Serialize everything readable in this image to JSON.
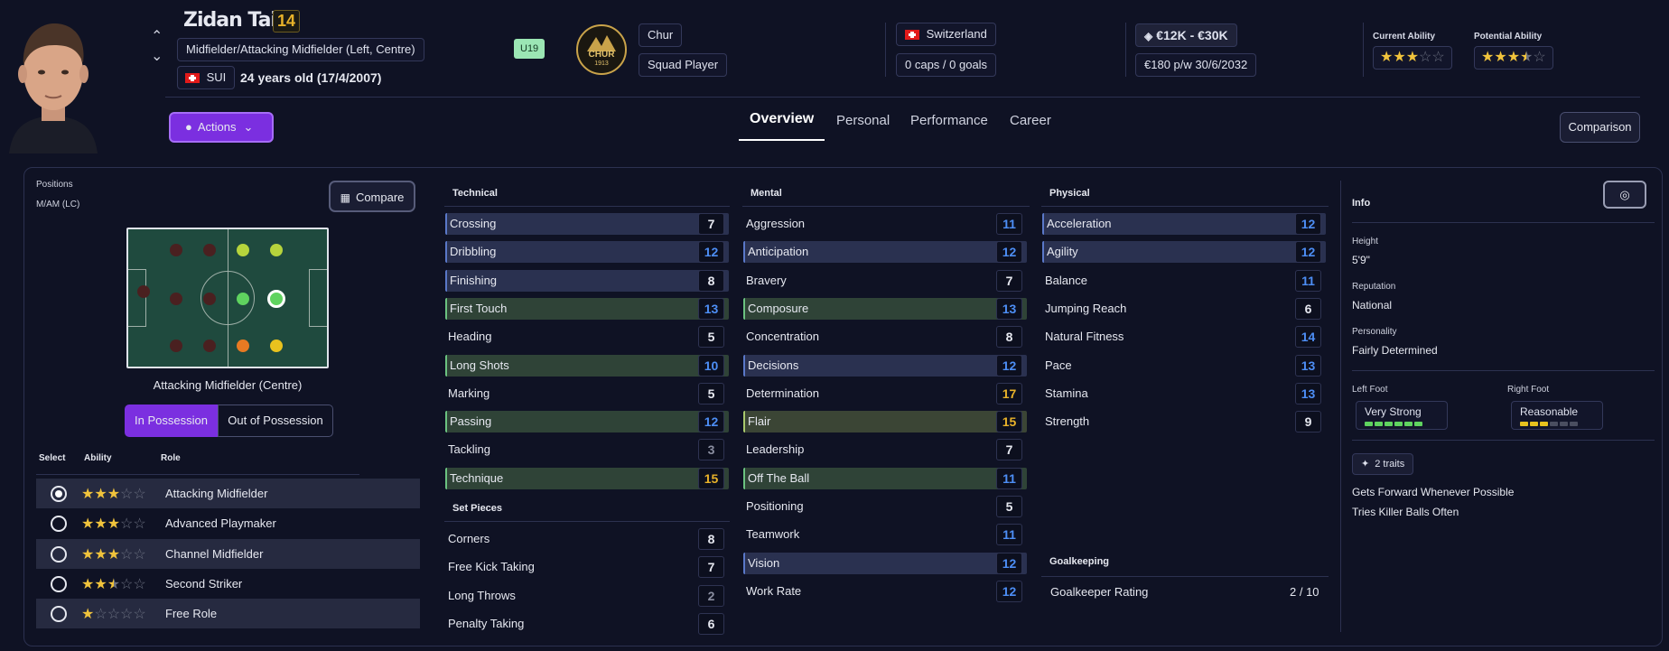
{
  "player": {
    "name": "Zidan Tairi",
    "number": "14",
    "position": "Midfielder/Attacking Midfielder (Left, Centre)",
    "nation_code": "SUI",
    "age": "24 years old (17/4/2007)",
    "age_group": "U19"
  },
  "club": {
    "name": "Chur",
    "role": "Squad Player",
    "badge_text": "CHUR",
    "badge_year": "1913"
  },
  "nation": {
    "name": "Switzerland",
    "caps": "0 caps / 0 goals"
  },
  "value": {
    "range": "€12K - €30K",
    "wage": "€180 p/w 30/6/2032"
  },
  "ability": {
    "current_label": "Current Ability",
    "potential_label": "Potential Ability",
    "current_stars": 3,
    "potential_stars": 3.5
  },
  "nav": {
    "actions": "Actions",
    "tabs": [
      "Overview",
      "Personal",
      "Performance",
      "Career"
    ],
    "active_tab": "Overview",
    "comparison": "Comparison"
  },
  "positions": {
    "label": "Positions",
    "value": "M/AM (LC)",
    "compare": "Compare",
    "pitch_caption": "Attacking Midfielder (Centre)",
    "in_possession": "In Possession",
    "out_possession": "Out of Possession"
  },
  "roles": {
    "headers": {
      "select": "Select",
      "ability": "Ability",
      "role": "Role"
    },
    "items": [
      {
        "name": "Attacking Midfielder",
        "stars": 3,
        "selected": true
      },
      {
        "name": "Advanced Playmaker",
        "stars": 3,
        "selected": false
      },
      {
        "name": "Channel Midfielder",
        "stars": 3,
        "selected": false
      },
      {
        "name": "Second Striker",
        "stars": 2.5,
        "selected": false
      },
      {
        "name": "Free Role",
        "stars": 1,
        "selected": false
      }
    ]
  },
  "attributes": {
    "technical": {
      "title": "Technical",
      "items": [
        {
          "name": "Crossing",
          "value": "7",
          "color": "white",
          "hl": "blue"
        },
        {
          "name": "Dribbling",
          "value": "12",
          "color": "blue",
          "hl": "blue"
        },
        {
          "name": "Finishing",
          "value": "8",
          "color": "white",
          "hl": "blue"
        },
        {
          "name": "First Touch",
          "value": "13",
          "color": "blue",
          "hl": "green"
        },
        {
          "name": "Heading",
          "value": "5",
          "color": "white",
          "hl": ""
        },
        {
          "name": "Long Shots",
          "value": "10",
          "color": "blue",
          "hl": "green"
        },
        {
          "name": "Marking",
          "value": "5",
          "color": "white",
          "hl": ""
        },
        {
          "name": "Passing",
          "value": "12",
          "color": "blue",
          "hl": "green"
        },
        {
          "name": "Tackling",
          "value": "3",
          "color": "grey",
          "hl": ""
        },
        {
          "name": "Technique",
          "value": "15",
          "color": "gold",
          "hl": "green"
        }
      ]
    },
    "set_pieces": {
      "title": "Set Pieces",
      "items": [
        {
          "name": "Corners",
          "value": "8",
          "color": "white",
          "hl": ""
        },
        {
          "name": "Free Kick Taking",
          "value": "7",
          "color": "white",
          "hl": ""
        },
        {
          "name": "Long Throws",
          "value": "2",
          "color": "grey",
          "hl": ""
        },
        {
          "name": "Penalty Taking",
          "value": "6",
          "color": "white",
          "hl": ""
        }
      ]
    },
    "mental": {
      "title": "Mental",
      "items": [
        {
          "name": "Aggression",
          "value": "11",
          "color": "blue",
          "hl": ""
        },
        {
          "name": "Anticipation",
          "value": "12",
          "color": "blue",
          "hl": "blue"
        },
        {
          "name": "Bravery",
          "value": "7",
          "color": "white",
          "hl": ""
        },
        {
          "name": "Composure",
          "value": "13",
          "color": "blue",
          "hl": "green"
        },
        {
          "name": "Concentration",
          "value": "8",
          "color": "white",
          "hl": ""
        },
        {
          "name": "Decisions",
          "value": "12",
          "color": "blue",
          "hl": "blue"
        },
        {
          "name": "Determination",
          "value": "17",
          "color": "gold",
          "hl": ""
        },
        {
          "name": "Flair",
          "value": "15",
          "color": "gold",
          "hl": "gold"
        },
        {
          "name": "Leadership",
          "value": "7",
          "color": "white",
          "hl": ""
        },
        {
          "name": "Off The Ball",
          "value": "11",
          "color": "blue",
          "hl": "green"
        },
        {
          "name": "Positioning",
          "value": "5",
          "color": "white",
          "hl": ""
        },
        {
          "name": "Teamwork",
          "value": "11",
          "color": "blue",
          "hl": ""
        },
        {
          "name": "Vision",
          "value": "12",
          "color": "blue",
          "hl": "blue"
        },
        {
          "name": "Work Rate",
          "value": "12",
          "color": "blue",
          "hl": ""
        }
      ]
    },
    "physical": {
      "title": "Physical",
      "items": [
        {
          "name": "Acceleration",
          "value": "12",
          "color": "blue",
          "hl": "blue"
        },
        {
          "name": "Agility",
          "value": "12",
          "color": "blue",
          "hl": "blue"
        },
        {
          "name": "Balance",
          "value": "11",
          "color": "blue",
          "hl": ""
        },
        {
          "name": "Jumping Reach",
          "value": "6",
          "color": "white",
          "hl": ""
        },
        {
          "name": "Natural Fitness",
          "value": "14",
          "color": "blue",
          "hl": ""
        },
        {
          "name": "Pace",
          "value": "13",
          "color": "blue",
          "hl": ""
        },
        {
          "name": "Stamina",
          "value": "13",
          "color": "blue",
          "hl": ""
        },
        {
          "name": "Strength",
          "value": "9",
          "color": "white",
          "hl": ""
        }
      ]
    },
    "goalkeeping": {
      "title": "Goalkeeping",
      "label": "Goalkeeper Rating",
      "value": "2 / 10"
    }
  },
  "info": {
    "title": "Info",
    "height_label": "Height",
    "height": "5'9\"",
    "reputation_label": "Reputation",
    "reputation": "National",
    "personality_label": "Personality",
    "personality": "Fairly Determined",
    "left_foot_label": "Left Foot",
    "left_foot": "Very Strong",
    "left_foot_level": 6,
    "right_foot_label": "Right Foot",
    "right_foot": "Reasonable",
    "right_foot_level": 3,
    "traits_button": "2 traits",
    "traits": [
      "Gets Forward Whenever Possible",
      "Tries Killer Balls Often"
    ]
  },
  "colors": {
    "accent": "#7b2fe0",
    "blue_value": "#4d8ef5",
    "gold_value": "#e8b22a",
    "green_foot": "#5fd35f",
    "yellow_foot": "#e8c21e"
  }
}
